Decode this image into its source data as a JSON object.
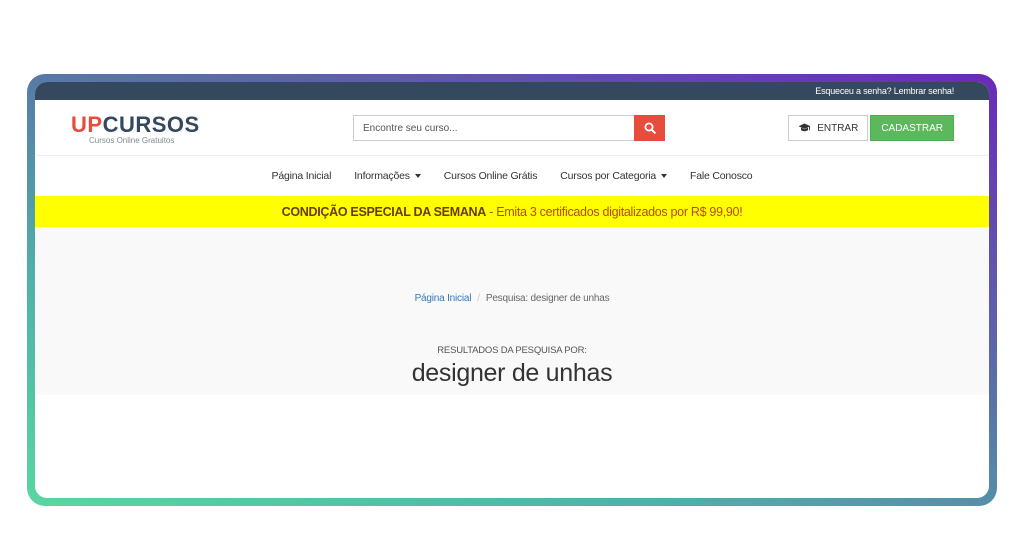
{
  "topbar": {
    "forgot_password": "Esqueceu a senha? Lembrar senha!"
  },
  "logo": {
    "up": "UP",
    "cursos": "CURSOS",
    "tagline": "Cursos Online Gratuitos"
  },
  "search": {
    "placeholder": "Encontre seu curso...",
    "button_icon": "search-icon"
  },
  "auth": {
    "login_label": "ENTRAR",
    "login_icon": "graduation-cap-icon",
    "register_label": "CADASTRAR"
  },
  "nav": {
    "items": [
      {
        "label": "Página Inicial",
        "has_dropdown": false
      },
      {
        "label": "Informações",
        "has_dropdown": true
      },
      {
        "label": "Cursos Online Grátis",
        "has_dropdown": false
      },
      {
        "label": "Cursos por Categoria",
        "has_dropdown": true
      },
      {
        "label": "Fale Conosco",
        "has_dropdown": false
      }
    ]
  },
  "promo": {
    "title": "CONDIÇÃO ESPECIAL DA SEMANA",
    "text": " - Emita 3 certificados digitalizados por R$ 99,90!"
  },
  "breadcrumb": {
    "home": "Página Inicial",
    "separator": "/",
    "current": "Pesquisa: designer de unhas"
  },
  "results": {
    "label": "RESULTADOS DA PESQUISA POR:",
    "term": "designer de unhas"
  },
  "colors": {
    "topbar": "#34495e",
    "logo_red": "#e74c3c",
    "logo_dark": "#34495e",
    "search_button": "#e74c3c",
    "register_button": "#5cb85c",
    "promo_bg": "#ffff00",
    "link": "#337ab7"
  }
}
